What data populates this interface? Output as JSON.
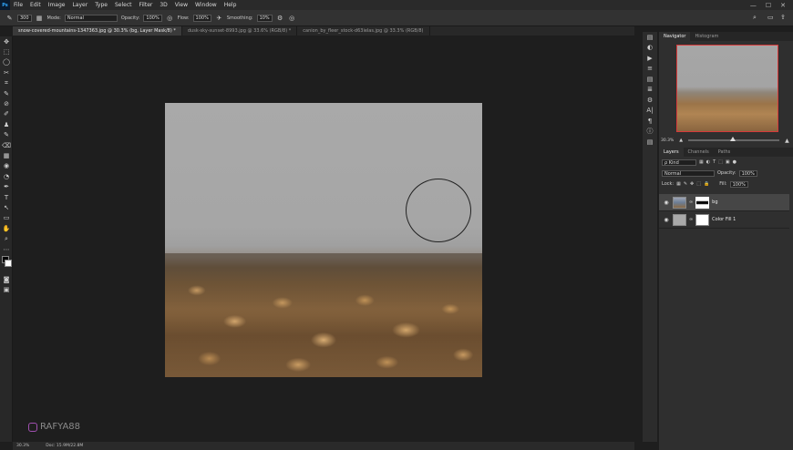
{
  "menu": {
    "app_icon": "Ps",
    "items": [
      "File",
      "Edit",
      "Image",
      "Layer",
      "Type",
      "Select",
      "Filter",
      "3D",
      "View",
      "Window",
      "Help"
    ],
    "window_buttons": [
      "—",
      "☐",
      "✕"
    ]
  },
  "options": {
    "brush_size": "300",
    "mode_label": "Mode:",
    "mode_value": "Normal",
    "opacity_label": "Opacity:",
    "opacity_value": "100%",
    "flow_label": "Flow:",
    "flow_value": "100%",
    "smoothing_label": "Smoothing:",
    "smoothing_value": "10%"
  },
  "tabs": [
    {
      "label": "snow-covered-mountains-1347363.jpg @ 30.3% (bg, Layer Mask/8) *",
      "active": true
    },
    {
      "label": "dusk-sky-sunset-8993.jpg @ 33.6% (RGB/8) *",
      "active": false
    },
    {
      "label": "canion_by_fleer_stock-d63ielas.jpg @ 33.3% (RGB/8)",
      "active": false
    }
  ],
  "tools": [
    "✥",
    "⬚",
    "◯",
    "✂",
    "⌗",
    "✎",
    "⊘",
    "✐",
    "♟",
    "✎",
    "⌫",
    "▦",
    "◉",
    "◔",
    "✒",
    "T",
    "↖",
    "▭",
    "✋",
    "⌕",
    "⋯"
  ],
  "panel_icons": [
    "▤",
    "◐",
    "▶",
    "≡",
    "▤",
    "≣",
    "⚙",
    "A|",
    "¶",
    "ⓘ",
    "▤"
  ],
  "navigator": {
    "tabs": [
      "Navigator",
      "Histogram"
    ],
    "zoom": "30.3%"
  },
  "layers": {
    "tabs": [
      "Layers",
      "Channels",
      "Paths"
    ],
    "filter_label": "ρ Kind",
    "blend_mode": "Normal",
    "opacity_label": "Opacity:",
    "opacity_value": "100%",
    "lock_label": "Lock:",
    "fill_label": "Fill:",
    "fill_value": "100%",
    "items": [
      {
        "name": "bg",
        "selected": true
      },
      {
        "name": "Color Fill 1",
        "selected": false
      }
    ]
  },
  "status": {
    "zoom": "30.3%",
    "doc": "Doc: 15.9M/22.8M"
  },
  "watermark": "RAFYA88"
}
